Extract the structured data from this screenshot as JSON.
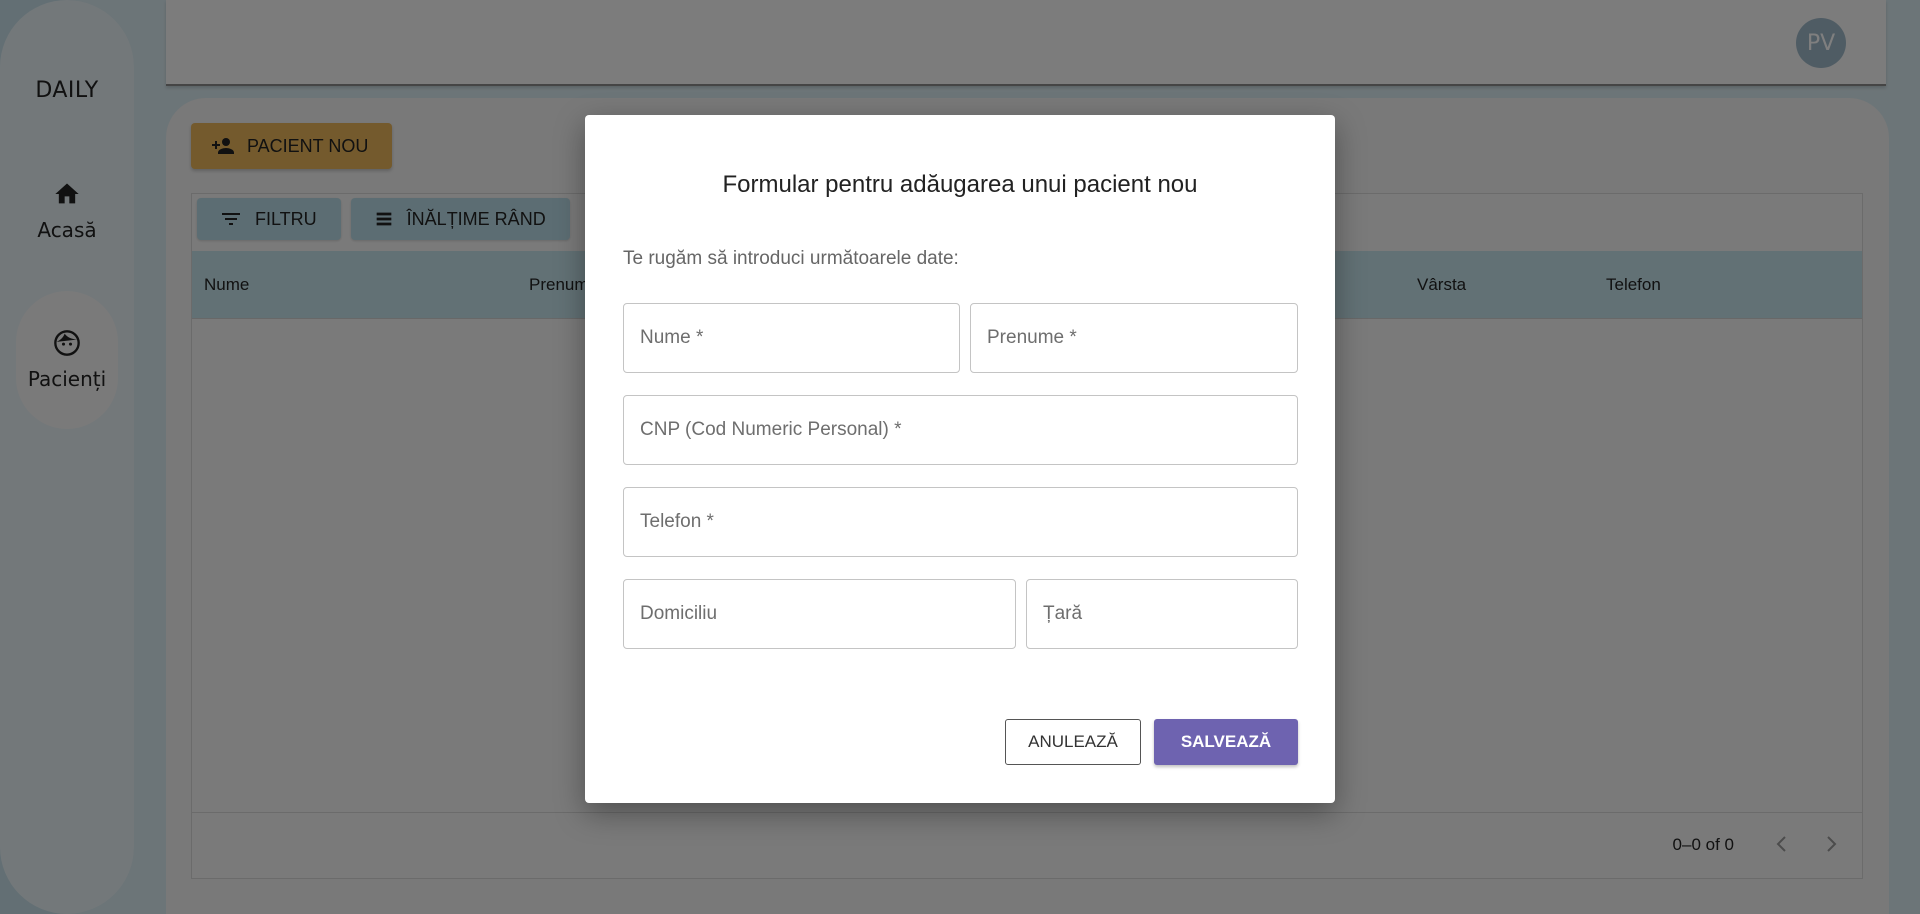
{
  "sidebar": {
    "brand": "DAILY",
    "items": [
      {
        "label": "Acasă",
        "icon": "home-icon"
      },
      {
        "label": "Pacienți",
        "icon": "face-icon"
      }
    ]
  },
  "header": {
    "avatar_initials": "PV"
  },
  "main": {
    "new_patient_label": "PACIENT NOU",
    "toolbar": {
      "filter_label": "FILTRU",
      "density_label": "ÎNĂLȚIME RÂND"
    },
    "columns": [
      "Nume",
      "Prenum",
      "Vârsta",
      "Telefon"
    ],
    "pagination": {
      "range_text": "0–0 of 0"
    }
  },
  "dialog": {
    "title": "Formular pentru adăugarea unui pacient nou",
    "subtitle": "Te rugăm să introduci următoarele date:",
    "fields": {
      "nume": {
        "placeholder": "Nume *",
        "value": ""
      },
      "prenume": {
        "placeholder": "Prenume *",
        "value": ""
      },
      "cnp": {
        "placeholder": "CNP (Cod Numeric Personal) *",
        "value": ""
      },
      "telefon": {
        "placeholder": "Telefon *",
        "value": ""
      },
      "domiciliu": {
        "placeholder": "Domiciliu",
        "value": ""
      },
      "tara": {
        "placeholder": "Țară",
        "value": ""
      }
    },
    "cancel_label": "ANULEAZĂ",
    "save_label": "SALVEAZĂ"
  },
  "colors": {
    "accent_primary": "#6e63b0",
    "new_patient_button": "#e8b55a",
    "toolbar_button": "#b9dbe6",
    "table_header": "#c5e2eb"
  }
}
